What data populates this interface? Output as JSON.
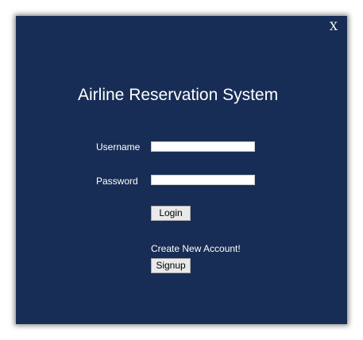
{
  "window": {
    "close_label": "X",
    "background_color": "#172d55",
    "text_color": "#ffffff"
  },
  "title": "Airline Reservation System",
  "login_form": {
    "username_label": "Username",
    "username_value": "",
    "password_label": "Password",
    "password_value": "",
    "login_button": "Login"
  },
  "signup": {
    "prompt": "Create New Account!",
    "signup_button": "Signup"
  }
}
